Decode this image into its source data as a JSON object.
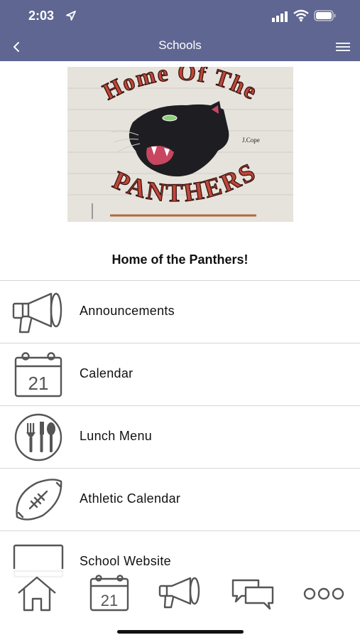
{
  "status_bar": {
    "time": "2:03"
  },
  "nav": {
    "title": "Schools"
  },
  "hero": {
    "line1": "Home Of The",
    "line2": "PANTHERS",
    "signature": "J.Cope"
  },
  "headline": "Home of the Panthers!",
  "menu": [
    {
      "label": "Announcements",
      "icon": "megaphone-icon"
    },
    {
      "label": "Calendar",
      "icon": "calendar-icon",
      "day": "21"
    },
    {
      "label": "Lunch Menu",
      "icon": "utensils-icon"
    },
    {
      "label": "Athletic Calendar",
      "icon": "football-icon"
    },
    {
      "label": "School Website",
      "icon": "monitor-icon"
    }
  ],
  "tabbar": {
    "calendar_day": "21"
  },
  "colors": {
    "header": "#5e6691",
    "icon_stroke": "#555555",
    "text": "#111111"
  }
}
